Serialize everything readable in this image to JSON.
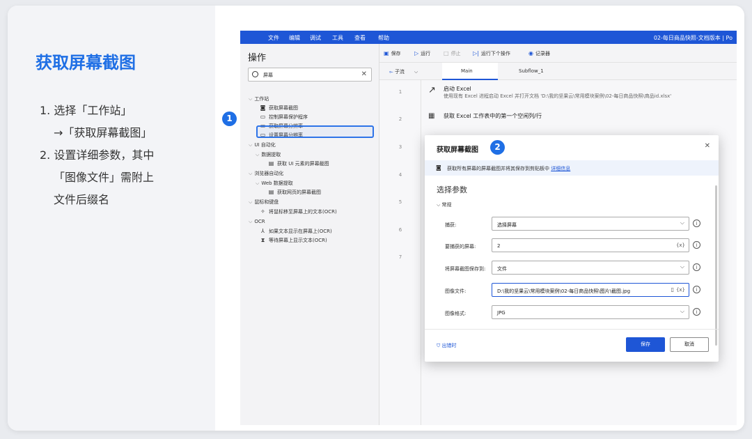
{
  "slide": {
    "title": "获取屏幕截图",
    "steps": [
      "1. 选择「工作站」",
      "→「获取屏幕截图」",
      "2. 设置详细参数，其中",
      "「图像文件」需附上",
      "文件后缀名"
    ]
  },
  "app": {
    "menu": [
      "文件",
      "编辑",
      "调试",
      "工具",
      "查看",
      "帮助"
    ],
    "window_title": "02-每日商品快照-文档版本 | Po",
    "toolbar": [
      "保存",
      "运行",
      "停止",
      "运行下个操作",
      "记录器"
    ],
    "actions_title": "操作",
    "search_value": "屏幕",
    "tree": [
      {
        "label": "工作站",
        "level": 0
      },
      {
        "label": "获取屏幕截图",
        "level": 1
      },
      {
        "label": "控制屏幕保护程序",
        "level": 1
      },
      {
        "label": "获取屏幕分辨率",
        "level": 1
      },
      {
        "label": "设置屏幕分辨率",
        "level": 1
      },
      {
        "label": "UI 自动化",
        "level": 0
      },
      {
        "label": "数据提取",
        "level": 1
      },
      {
        "label": "获取 UI 元素的屏幕截图",
        "level": 2
      },
      {
        "label": "浏览器自动化",
        "level": 0
      },
      {
        "label": "Web 数据提取",
        "level": 1
      },
      {
        "label": "获取网页的屏幕截图",
        "level": 2
      },
      {
        "label": "鼠标和键盘",
        "level": 0
      },
      {
        "label": "将鼠标移至屏幕上的文本(OCR)",
        "level": 2
      },
      {
        "label": "OCR",
        "level": 0
      },
      {
        "label": "如果文本显示在屏幕上(OCR)",
        "level": 2
      },
      {
        "label": "等待屏幕上显示文本(OCR)",
        "level": 2
      }
    ],
    "tabs": {
      "subflow_label": "子流",
      "main": "Main",
      "sub1": "Subflow_1"
    },
    "line_numbers": [
      "1",
      "2",
      "3",
      "4",
      "5",
      "6",
      "7"
    ],
    "flow_steps": [
      {
        "title": "启动 Excel",
        "desc": "使用现有 Excel 进程启动 Excel 并打开文档 'D:\\我的坚果云\\常用模块案例\\02-每日商品快照\\商品id.xlsx'"
      },
      {
        "title": "获取 Excel 工作表中的第一个空闲列/行",
        "desc": ""
      }
    ]
  },
  "dialog": {
    "title": "获取屏幕截图",
    "info_text": "获取所有屏幕的屏幕截图并将其保存到剪贴板中",
    "info_link": "详细信息",
    "section": "选择参数",
    "group": "常规",
    "fields": [
      {
        "label": "捕获:",
        "value": "选择屏幕"
      },
      {
        "label": "要捕获的屏幕:",
        "value": "2"
      },
      {
        "label": "将屏幕截图保存到:",
        "value": "文件"
      },
      {
        "label": "图像文件:",
        "value": "D:\\我的坚果云\\常用模块案例\\02-每日商品快照\\图片\\截图.jpg"
      },
      {
        "label": "图像格式:",
        "value": "JPG"
      }
    ],
    "timeout_label": "出错时",
    "save_label": "保存",
    "cancel_label": "取消"
  },
  "badges": {
    "one": "1",
    "two": "2"
  },
  "colors": {
    "accent": "#1f6fe5",
    "menubar": "#1e56d6"
  }
}
